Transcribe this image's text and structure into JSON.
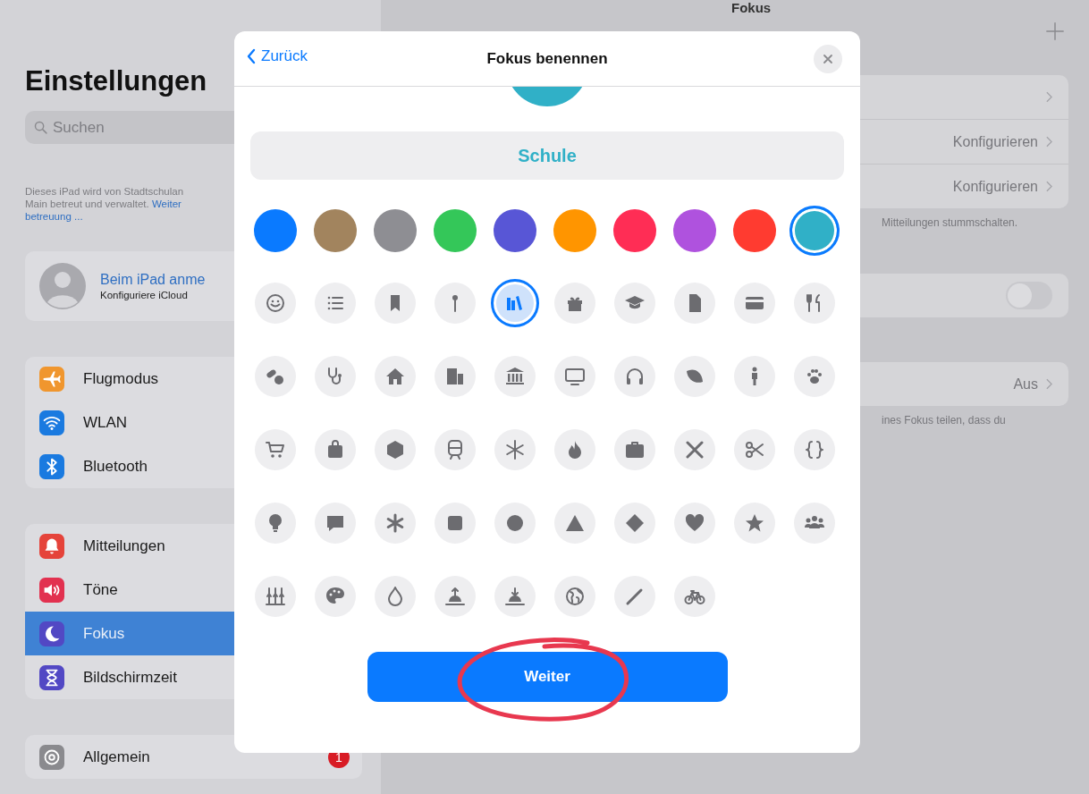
{
  "sidebar": {
    "title": "Einstellungen",
    "search": {
      "placeholder": "Suchen"
    },
    "note": {
      "text_1": "Dieses iPad wird von Stadtschulan",
      "text_2": "Main betreut und verwaltet.",
      "link_1": "Weiter",
      "link_2": "betreuung ..."
    },
    "profile": {
      "name": "Beim iPad anme",
      "subtitle": "Konfiguriere iCloud"
    },
    "groups": [
      [
        {
          "label": "Flugmodus",
          "color": "#f0962e",
          "selected": false
        },
        {
          "label": "WLAN",
          "color": "#1a7ae0",
          "selected": false
        },
        {
          "label": "Bluetooth",
          "color": "#1a7ae0",
          "selected": false
        }
      ],
      [
        {
          "label": "Mitteilungen",
          "color": "#e5433a",
          "selected": false
        },
        {
          "label": "Töne",
          "color": "#e23150",
          "selected": false
        },
        {
          "label": "Fokus",
          "color": "#5248c4",
          "selected": true
        },
        {
          "label": "Bildschirmzeit",
          "color": "#5248c4",
          "selected": false
        }
      ],
      [
        {
          "label": "Allgemein",
          "color": "#8a8a8e",
          "selected": false,
          "badge": "1"
        }
      ]
    ]
  },
  "detail": {
    "title": "Fokus",
    "cards": [
      {
        "rows": [
          {
            "kind": "chevron"
          },
          {
            "kind": "value",
            "value": "Konfigurieren"
          },
          {
            "kind": "value",
            "value": "Konfigurieren"
          }
        ],
        "footer": "Mitteilungen stummschalten."
      },
      {
        "rows": [
          {
            "kind": "toggle",
            "on": false
          }
        ]
      },
      {
        "rows": [
          {
            "kind": "value",
            "value": "Aus"
          }
        ],
        "footer": "ines Fokus teilen, dass du"
      }
    ]
  },
  "modal": {
    "back": "Zurück",
    "title": "Fokus benennen",
    "name": {
      "value": "Schule"
    },
    "colors": [
      {
        "color": "#0a7aff",
        "selected": false
      },
      {
        "color": "#a2845e",
        "selected": false
      },
      {
        "color": "#8e8e93",
        "selected": false
      },
      {
        "color": "#34c759",
        "selected": false
      },
      {
        "color": "#5856d6",
        "selected": false
      },
      {
        "color": "#ff9500",
        "selected": false
      },
      {
        "color": "#ff2d55",
        "selected": false
      },
      {
        "color": "#af52de",
        "selected": false
      },
      {
        "color": "#ff3b30",
        "selected": false
      },
      {
        "color": "#30b0c7",
        "selected": true
      }
    ],
    "symbols": [
      {
        "selected": false
      },
      {
        "selected": false
      },
      {
        "selected": false
      },
      {
        "selected": false
      },
      {
        "selected": true
      },
      {
        "selected": false
      },
      {
        "selected": false
      },
      {
        "selected": false
      },
      {
        "selected": false
      },
      {
        "selected": false
      },
      {
        "selected": false
      },
      {
        "selected": false
      },
      {
        "selected": false
      },
      {
        "selected": false
      },
      {
        "selected": false
      },
      {
        "selected": false
      },
      {
        "selected": false
      },
      {
        "selected": false
      },
      {
        "selected": false
      },
      {
        "selected": false
      },
      {
        "selected": false
      },
      {
        "selected": false
      },
      {
        "selected": false
      },
      {
        "selected": false
      },
      {
        "selected": false
      },
      {
        "selected": false
      },
      {
        "selected": false
      },
      {
        "selected": false
      },
      {
        "selected": false
      },
      {
        "selected": false
      },
      {
        "selected": false
      },
      {
        "selected": false
      },
      {
        "selected": false
      },
      {
        "selected": false
      },
      {
        "selected": false
      },
      {
        "selected": false
      },
      {
        "selected": false
      },
      {
        "selected": false
      },
      {
        "selected": false
      },
      {
        "selected": false
      },
      {
        "selected": false
      },
      {
        "selected": false
      },
      {
        "selected": false
      },
      {
        "selected": false
      },
      {
        "selected": false
      },
      {
        "selected": false
      },
      {
        "selected": false
      },
      {
        "selected": false
      }
    ],
    "button": "Weiter"
  }
}
